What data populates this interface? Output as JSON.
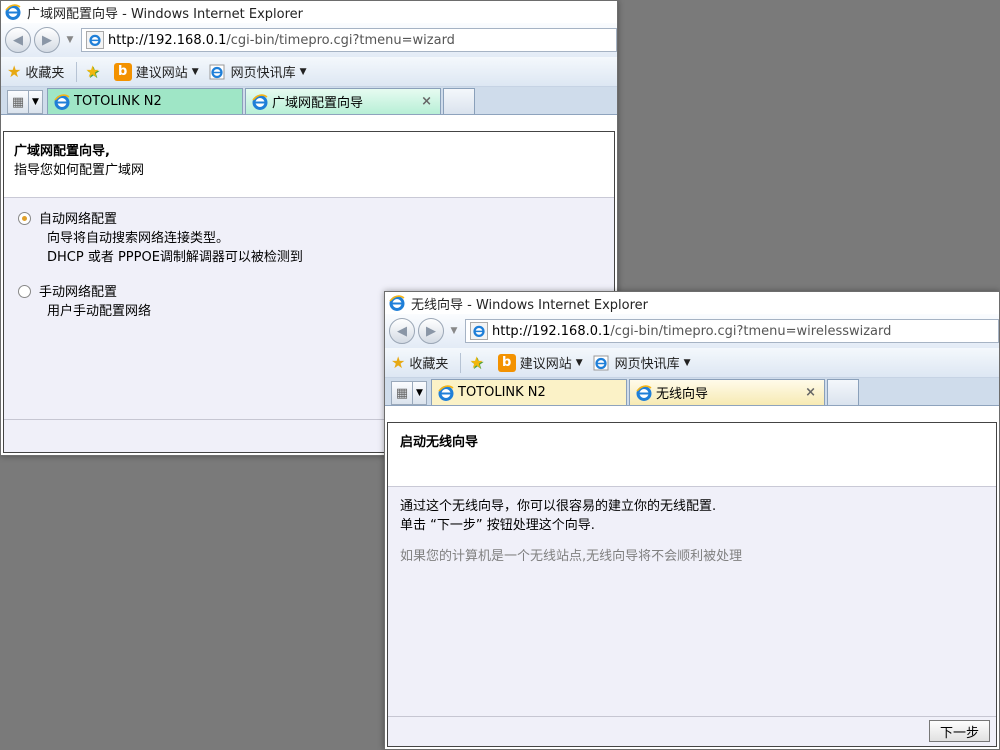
{
  "window1": {
    "title": "广域网配置向导 - Windows Internet Explorer",
    "address_host": "http://192.168.0.1",
    "address_path": "/cgi-bin/timepro.cgi?tmenu=wizard",
    "favbar": {
      "favorites": "收藏夹",
      "suggested": "建议网站",
      "slices": "网页快讯库"
    },
    "tabs": [
      {
        "label": "TOTOLINK N2"
      },
      {
        "label": "广域网配置向导",
        "close": "×"
      }
    ],
    "page": {
      "title": "广域网配置向导,",
      "subtitle": "指导您如何配置广域网",
      "options": [
        {
          "label": "自动网络配置",
          "desc1": "向导将自动搜索网络连接类型。",
          "desc2": "DHCP 或者  PPPOE调制解调器可以被检测到",
          "selected": true
        },
        {
          "label": "手动网络配置",
          "desc1": "用户手动配置网络",
          "selected": false
        }
      ]
    }
  },
  "window2": {
    "title": "无线向导 - Windows Internet Explorer",
    "address_host": "http://192.168.0.1",
    "address_path": "/cgi-bin/timepro.cgi?tmenu=wirelesswizard",
    "favbar": {
      "favorites": "收藏夹",
      "suggested": "建议网站",
      "slices": "网页快讯库"
    },
    "tabs": [
      {
        "label": "TOTOLINK N2"
      },
      {
        "label": "无线向导",
        "close": "×"
      }
    ],
    "page": {
      "title": "启动无线向导",
      "line1": "通过这个无线向导，你可以很容易的建立你的无线配置.",
      "line2": "单击 “下一步” 按钮处理这个向导.",
      "note": "如果您的计算机是一个无线站点,无线向导将不会顺利被处理",
      "next_button": "下一步"
    }
  }
}
